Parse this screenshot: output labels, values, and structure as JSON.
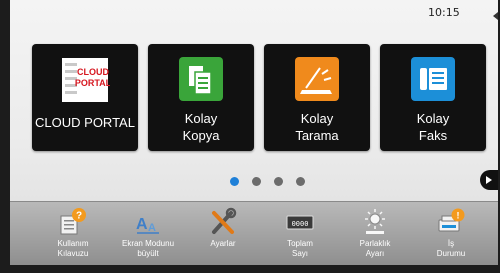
{
  "status": {
    "time": "10:15"
  },
  "tiles": [
    {
      "label": "CLOUD PORTAL",
      "icon": "cloud-portal-icon"
    },
    {
      "label_line1": "Kolay",
      "label_line2": "Kopya",
      "icon": "copy-icon",
      "color": "#3aa53a"
    },
    {
      "label_line1": "Kolay",
      "label_line2": "Tarama",
      "icon": "scan-icon",
      "color": "#f08a1c"
    },
    {
      "label_line1": "Kolay",
      "label_line2": "Faks",
      "icon": "fax-icon",
      "color": "#1c8fd8"
    }
  ],
  "cloud_portal_logo": {
    "line1": "CLOUD",
    "line2": "PORTAL"
  },
  "pagination": {
    "pages": 4,
    "current": 1
  },
  "bottom_bar": [
    {
      "line1": "Kullanım",
      "line2": "Kılavuzu",
      "icon": "user-guide-icon"
    },
    {
      "line1": "Ekran Modunu",
      "line2": "büyült",
      "icon": "enlarge-display-icon"
    },
    {
      "line1": "Ayarlar",
      "line2": "",
      "icon": "settings-icon"
    },
    {
      "line1": "Toplam",
      "line2": "Sayı",
      "icon": "total-count-icon",
      "counter": "0000"
    },
    {
      "line1": "Parlaklık",
      "line2": "Ayarı",
      "icon": "brightness-icon"
    },
    {
      "line1": "İş",
      "line2": "Durumu",
      "icon": "job-status-icon"
    }
  ],
  "colors": {
    "accent": "#1f80d8",
    "tile_bg": "#111111",
    "dot_inactive": "#6c6c6c"
  }
}
